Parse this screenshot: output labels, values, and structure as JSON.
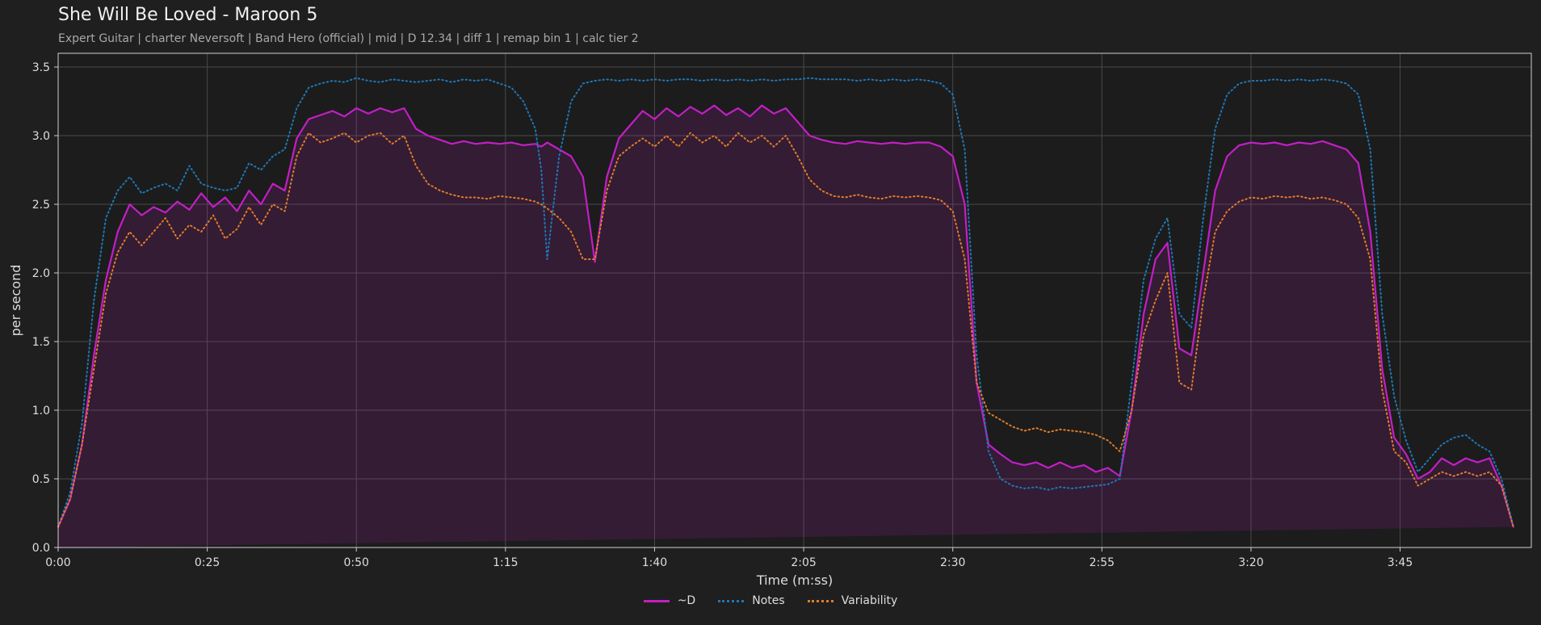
{
  "header": {
    "title": "She Will Be Loved - Maroon 5",
    "subtitle": "Expert Guitar  |  charter Neversoft  |  Band Hero (official)  |  mid  |  D 12.34  |  diff 1  |  remap bin 1  |  calc tier 2"
  },
  "chart_data": {
    "type": "line",
    "xlabel": "Time (m:ss)",
    "ylabel": "per second",
    "xlim": [
      0,
      247
    ],
    "ylim": [
      0,
      3.6
    ],
    "x_ticks": [
      0,
      25,
      50,
      75,
      100,
      125,
      150,
      175,
      200,
      225
    ],
    "x_tick_labels": [
      "0:00",
      "0:25",
      "0:50",
      "1:15",
      "1:40",
      "2:05",
      "2:30",
      "2:55",
      "3:20",
      "3:45"
    ],
    "y_ticks": [
      0.0,
      0.5,
      1.0,
      1.5,
      2.0,
      2.5,
      3.0,
      3.5
    ],
    "y_tick_labels": [
      "0.0",
      "0.5",
      "1.0",
      "1.5",
      "2.0",
      "2.5",
      "3.0",
      "3.5"
    ],
    "grid": true,
    "legend_position": "bottom-center",
    "x": [
      0,
      2,
      4,
      6,
      8,
      10,
      12,
      14,
      16,
      18,
      20,
      22,
      24,
      26,
      28,
      30,
      32,
      34,
      36,
      38,
      40,
      42,
      44,
      46,
      48,
      50,
      52,
      54,
      56,
      58,
      60,
      62,
      64,
      66,
      68,
      70,
      72,
      74,
      76,
      78,
      80,
      81,
      82,
      84,
      86,
      88,
      90,
      92,
      94,
      96,
      98,
      100,
      102,
      104,
      106,
      108,
      110,
      112,
      114,
      116,
      118,
      120,
      122,
      124,
      126,
      128,
      130,
      132,
      134,
      136,
      138,
      140,
      142,
      144,
      146,
      148,
      150,
      152,
      154,
      156,
      158,
      160,
      162,
      164,
      166,
      168,
      170,
      172,
      174,
      176,
      178,
      180,
      182,
      184,
      186,
      188,
      190,
      192,
      194,
      196,
      198,
      200,
      202,
      204,
      206,
      208,
      210,
      212,
      214,
      216,
      218,
      220,
      222,
      224,
      226,
      228,
      230,
      232,
      234,
      236,
      238,
      240,
      242,
      244,
      246,
      247
    ],
    "series": [
      {
        "name": "~D",
        "color": "#c21fc4",
        "style": "solid",
        "fill": true,
        "values": [
          0.15,
          0.35,
          0.75,
          1.4,
          1.95,
          2.3,
          2.5,
          2.42,
          2.48,
          2.44,
          2.52,
          2.46,
          2.58,
          2.48,
          2.55,
          2.45,
          2.6,
          2.5,
          2.65,
          2.6,
          2.98,
          3.12,
          3.15,
          3.18,
          3.14,
          3.2,
          3.16,
          3.2,
          3.17,
          3.2,
          3.05,
          3.0,
          2.97,
          2.94,
          2.96,
          2.94,
          2.95,
          2.94,
          2.95,
          2.93,
          2.94,
          2.92,
          2.95,
          2.9,
          2.85,
          2.7,
          2.08,
          2.7,
          2.98,
          3.08,
          3.18,
          3.12,
          3.2,
          3.14,
          3.21,
          3.16,
          3.22,
          3.15,
          3.2,
          3.14,
          3.22,
          3.16,
          3.2,
          3.1,
          3.0,
          2.97,
          2.95,
          2.94,
          2.96,
          2.95,
          2.94,
          2.95,
          2.94,
          2.95,
          2.95,
          2.92,
          2.85,
          2.5,
          1.2,
          0.75,
          0.68,
          0.62,
          0.6,
          0.62,
          0.58,
          0.62,
          0.58,
          0.6,
          0.55,
          0.58,
          0.52,
          1.0,
          1.7,
          2.1,
          2.22,
          1.45,
          1.4,
          2.0,
          2.6,
          2.85,
          2.93,
          2.95,
          2.94,
          2.95,
          2.93,
          2.95,
          2.94,
          2.96,
          2.93,
          2.9,
          2.8,
          2.3,
          1.3,
          0.8,
          0.68,
          0.5,
          0.55,
          0.65,
          0.6,
          0.65,
          0.62,
          0.65,
          0.45,
          0.15
        ]
      },
      {
        "name": "Notes",
        "color": "#1f77b4",
        "style": "dotted",
        "values": [
          0.15,
          0.4,
          0.9,
          1.8,
          2.4,
          2.6,
          2.7,
          2.58,
          2.62,
          2.65,
          2.6,
          2.78,
          2.65,
          2.62,
          2.6,
          2.62,
          2.8,
          2.75,
          2.85,
          2.9,
          3.2,
          3.35,
          3.38,
          3.4,
          3.39,
          3.42,
          3.4,
          3.39,
          3.41,
          3.4,
          3.39,
          3.4,
          3.41,
          3.39,
          3.41,
          3.4,
          3.41,
          3.38,
          3.35,
          3.25,
          3.05,
          2.75,
          2.1,
          2.85,
          3.25,
          3.38,
          3.4,
          3.41,
          3.4,
          3.41,
          3.4,
          3.41,
          3.4,
          3.41,
          3.41,
          3.4,
          3.41,
          3.4,
          3.41,
          3.4,
          3.41,
          3.4,
          3.41,
          3.41,
          3.42,
          3.41,
          3.41,
          3.41,
          3.4,
          3.41,
          3.4,
          3.41,
          3.4,
          3.41,
          3.4,
          3.38,
          3.3,
          2.9,
          1.4,
          0.7,
          0.5,
          0.45,
          0.43,
          0.44,
          0.42,
          0.44,
          0.43,
          0.44,
          0.45,
          0.46,
          0.5,
          1.2,
          1.95,
          2.25,
          2.4,
          1.7,
          1.6,
          2.4,
          3.05,
          3.3,
          3.38,
          3.4,
          3.4,
          3.41,
          3.4,
          3.41,
          3.4,
          3.41,
          3.4,
          3.38,
          3.3,
          2.9,
          1.7,
          1.1,
          0.78,
          0.55,
          0.65,
          0.75,
          0.8,
          0.82,
          0.75,
          0.7,
          0.5,
          0.15
        ]
      },
      {
        "name": "Variability",
        "color": "#e07b28",
        "style": "dotted",
        "values": [
          0.15,
          0.35,
          0.75,
          1.3,
          1.85,
          2.15,
          2.3,
          2.2,
          2.3,
          2.4,
          2.25,
          2.35,
          2.3,
          2.42,
          2.25,
          2.32,
          2.48,
          2.35,
          2.5,
          2.45,
          2.85,
          3.02,
          2.95,
          2.98,
          3.02,
          2.95,
          3.0,
          3.02,
          2.94,
          3.0,
          2.78,
          2.65,
          2.6,
          2.57,
          2.55,
          2.55,
          2.54,
          2.56,
          2.55,
          2.54,
          2.52,
          2.5,
          2.47,
          2.4,
          2.3,
          2.1,
          2.1,
          2.6,
          2.85,
          2.92,
          2.98,
          2.92,
          3.0,
          2.92,
          3.02,
          2.95,
          3.0,
          2.92,
          3.02,
          2.95,
          3.0,
          2.92,
          3.0,
          2.85,
          2.68,
          2.6,
          2.56,
          2.55,
          2.57,
          2.55,
          2.54,
          2.56,
          2.55,
          2.56,
          2.55,
          2.53,
          2.45,
          2.1,
          1.2,
          0.98,
          0.93,
          0.88,
          0.85,
          0.87,
          0.84,
          0.86,
          0.85,
          0.84,
          0.82,
          0.78,
          0.7,
          1.0,
          1.55,
          1.8,
          2.0,
          1.2,
          1.15,
          1.8,
          2.3,
          2.45,
          2.52,
          2.55,
          2.54,
          2.56,
          2.55,
          2.56,
          2.54,
          2.55,
          2.53,
          2.5,
          2.4,
          2.1,
          1.15,
          0.7,
          0.62,
          0.45,
          0.5,
          0.55,
          0.52,
          0.55,
          0.52,
          0.55,
          0.45,
          0.15
        ]
      }
    ]
  }
}
